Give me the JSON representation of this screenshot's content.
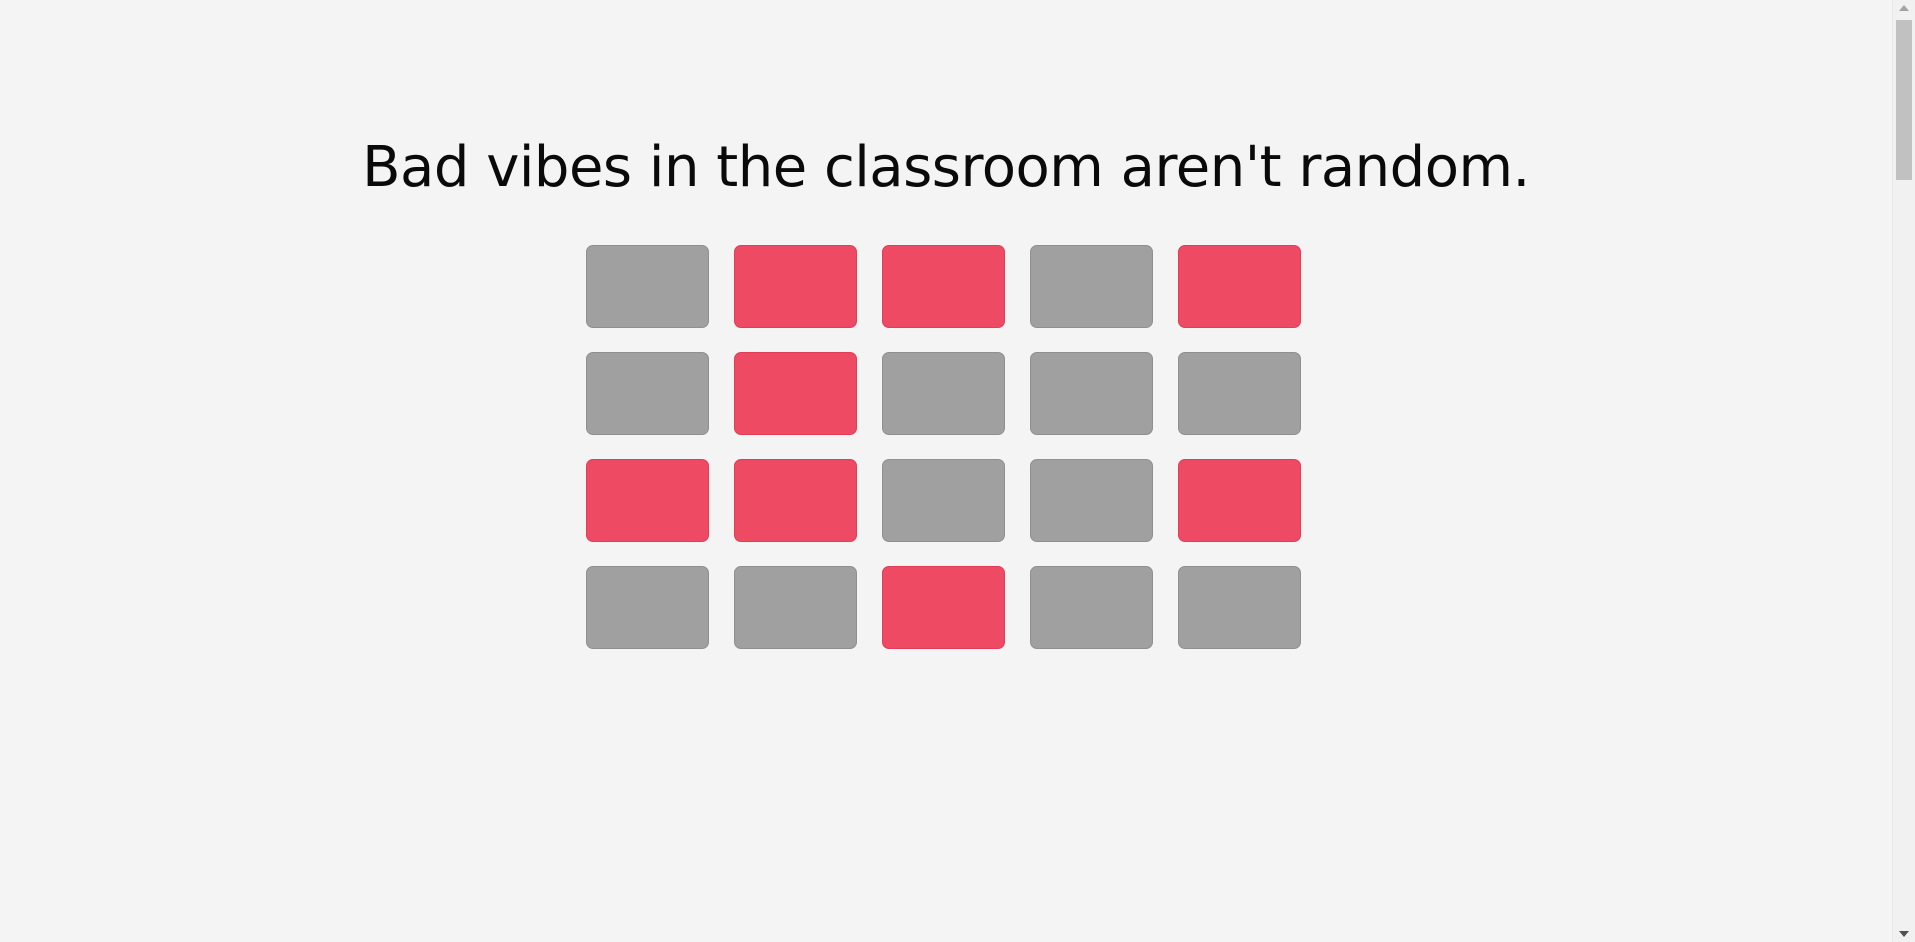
{
  "headline": "Bad vibes in the classroom aren't random.",
  "colors": {
    "background": "#f4f4f4",
    "seat_neutral": "#a0a0a0",
    "seat_highlight": "#ee4a64",
    "text": "#0a0a0a"
  },
  "seat_grid": {
    "rows": 4,
    "columns": 5,
    "seats": [
      [
        "gray",
        "red",
        "red",
        "gray",
        "red"
      ],
      [
        "gray",
        "red",
        "gray",
        "gray",
        "gray"
      ],
      [
        "red",
        "red",
        "gray",
        "gray",
        "red"
      ],
      [
        "gray",
        "gray",
        "red",
        "gray",
        "gray"
      ]
    ]
  }
}
